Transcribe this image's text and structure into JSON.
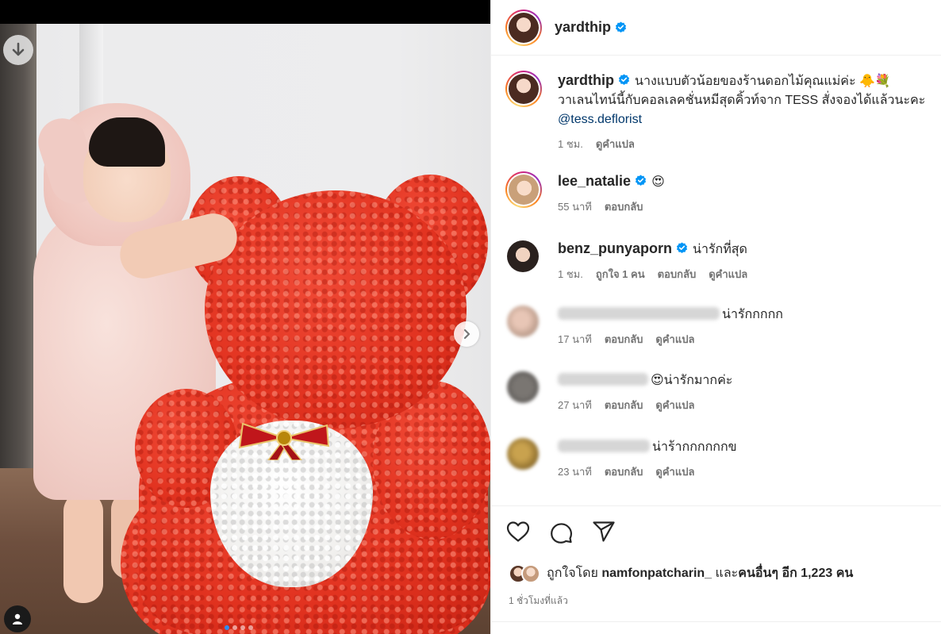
{
  "post": {
    "username": "yardthip",
    "caption_line1": "นางแบบตัวน้อยของร้านดอกไม้คุณแม่ค่ะ 🐥💐",
    "caption_line2": "วาเลนไทน์นี้กับคอลเลคชั่นหมีสุดคิ้วท์จาก TESS สั่งจองได้แล้วนะคะ",
    "mention": "@tess.deflorist",
    "caption_time": "1 ชม.",
    "caption_translate": "ดูคำแปล"
  },
  "comments": [
    {
      "username": "lee_natalie",
      "text": "😍",
      "time": "55 นาที",
      "reply": "ตอบกลับ"
    },
    {
      "username": "benz_punyaporn",
      "text": "น่ารักที่สุด",
      "time": "1 ชม.",
      "likes": "ถูกใจ 1 คน",
      "reply": "ตอบกลับ",
      "translate": "ดูคำแปล"
    },
    {
      "text": "น่ารักกกกก",
      "time": "17 นาที",
      "reply": "ตอบกลับ",
      "translate": "ดูคำแปล"
    },
    {
      "text": "😍น่ารักมากค่ะ",
      "time": "27 นาที",
      "reply": "ตอบกลับ",
      "translate": "ดูคำแปล"
    },
    {
      "text": "น่าร้ากกกกกกข",
      "time": "23 นาที",
      "reply": "ตอบกลับ",
      "translate": "ดูคำแปล"
    }
  ],
  "likes": {
    "prefix": "ถูกใจโดย",
    "liker": "namfonpatcharin_",
    "connector": "และ",
    "others": "คนอื่นๆ อีก 1,223 คน"
  },
  "posted_ago": "1 ชั่วโมงที่แล้ว",
  "carousel": {
    "slides": 4,
    "active": 1
  },
  "colors": {
    "verified": "#0095f6",
    "text": "#262626",
    "muted": "#737373",
    "active_dot": "#2f8cf0"
  }
}
